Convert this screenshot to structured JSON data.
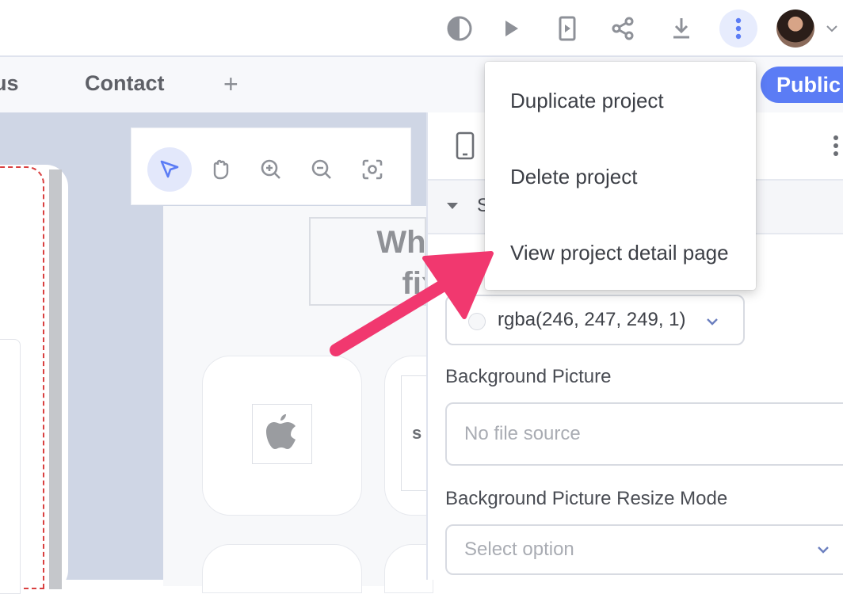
{
  "colors": {
    "accent": "#5b7cf5",
    "annotation_arrow": "#f1386f",
    "canvas_bg": "#cfd6e5"
  },
  "topbar": {
    "icons": [
      "contrast-icon",
      "play-icon",
      "mobile-preview-icon",
      "share-icon",
      "download-icon",
      "more-vertical-icon",
      "avatar",
      "chevron-down-icon"
    ]
  },
  "tabs": {
    "items": [
      {
        "label": "us"
      },
      {
        "label": "Contact"
      }
    ],
    "add_label": "+",
    "public_label": "Public"
  },
  "canvas_toolbar": {
    "tools": [
      "select-icon",
      "hand-icon",
      "zoom-in-icon",
      "zoom-out-icon",
      "focus-icon"
    ]
  },
  "canvas": {
    "heading": "What d fixe",
    "card_letter": "s"
  },
  "panel": {
    "section_label": "S",
    "color_value": "rgba(246, 247, 249, 1)",
    "background_picture_label": "Background Picture",
    "background_picture_placeholder": "No file source",
    "resize_mode_label": "Background Picture Resize Mode",
    "resize_mode_placeholder": "Select option"
  },
  "menu": {
    "items": [
      {
        "label": "Duplicate project"
      },
      {
        "label": "Delete project"
      },
      {
        "label": "View project detail page"
      }
    ]
  }
}
